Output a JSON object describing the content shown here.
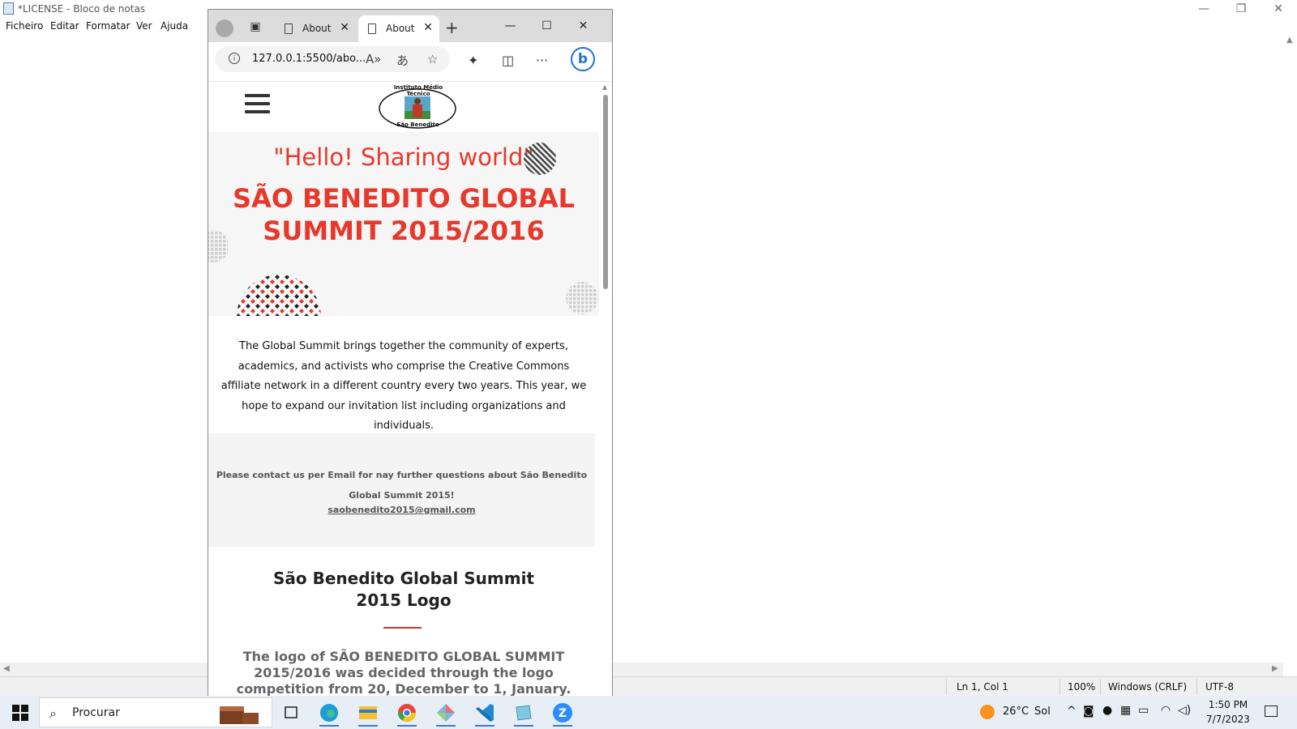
{
  "notepad": {
    "title": "*LICENSE - Bloco de notas",
    "menu": [
      "Ficheiro",
      "Editar",
      "Formatar",
      "Ver",
      "Ajuda"
    ],
    "status": {
      "position": "Ln 1, Col 1",
      "zoom": "100%",
      "line_ending": "Windows (CRLF)",
      "encoding": "UTF-8"
    },
    "controls": {
      "minimize": "—",
      "restore": "❐",
      "close": "✕"
    }
  },
  "browser": {
    "tabs": [
      {
        "label": "About",
        "active": false
      },
      {
        "label": "About",
        "active": true
      }
    ],
    "new_tab": "+",
    "url": "127.0.0.1:5500/abo...",
    "controls": {
      "minimize": "—",
      "maximize": "☐",
      "close": "✕"
    },
    "toolbar_icons": [
      "read-aloud-icon",
      "translate-icon",
      "favorite-icon",
      "extensions-icon",
      "split-screen-icon",
      "more-icon",
      "bing-icon"
    ]
  },
  "page": {
    "logo": {
      "arc_text": "Instituto Médio Técnico",
      "bottom_text": "São Benedito"
    },
    "hero": {
      "subtitle": "\"Hello! Sharing world\"",
      "title_line1": "SÃO BENEDITO GLOBAL",
      "title_line2": "SUMMIT 2015/2016"
    },
    "intro": "The Global Summit brings together the community of experts, academics, and activists who comprise the Creative Commons affiliate network in a different country every two years. This year, we hope to expand our invitation list including organizations and individuals.",
    "contact": {
      "text": "Please contact us per Email for nay further questions about São Benedito Global Summit 2015!",
      "email": "saobenedito2015@gmail.com"
    },
    "logo_section": {
      "heading_line1": "São Benedito Global Summit",
      "heading_line2": "2015 Logo",
      "description": "The logo of SÃO BENEDITO GLOBAL SUMMIT 2015/2016 was decided through the logo competition from 20, December to 1, January."
    }
  },
  "taskbar": {
    "search_placeholder": "Procurar",
    "apps": [
      "task-view",
      "edge",
      "file-explorer",
      "chrome",
      "git",
      "vscode",
      "notepad",
      "zoom"
    ],
    "weather": {
      "temp": "26°C",
      "condition": "Sol"
    },
    "time": "1:50 PM",
    "date": "7/7/2023"
  },
  "colors": {
    "accent_red": "#e7392b",
    "taskbar": "#e8eef6",
    "edge_blue": "#1b75d0"
  }
}
